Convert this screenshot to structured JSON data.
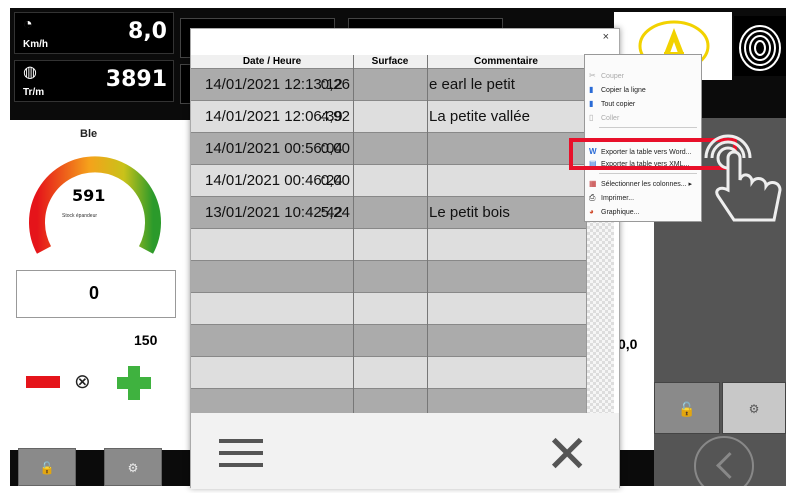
{
  "speed": {
    "value": "8,0",
    "unit": "Km/h",
    "icon": "speedometer-icon"
  },
  "rotation": {
    "value": "3891",
    "unit": "Tr/m",
    "icon": "rotor-icon"
  },
  "left_panel": {
    "crop_name": "Ble",
    "gauge_value": "591",
    "gauge_sub": "Stock épandeur",
    "counter": "0",
    "rate": "150"
  },
  "right_panel": {
    "rate_partial": "0,0"
  },
  "table": {
    "headers": {
      "date": "Date / Heure",
      "surface": "Surface",
      "comment": "Commentaire"
    },
    "rows": [
      {
        "date": "14/01/2021 12:13:12",
        "surface": "0,26",
        "comment": "e earl le petit"
      },
      {
        "date": "14/01/2021 12:06:39",
        "surface": "4,92",
        "comment": "La petite vallée"
      },
      {
        "date": "14/01/2021 00:56:04",
        "surface": "0,00",
        "comment": ""
      },
      {
        "date": "14/01/2021 00:46:24",
        "surface": "0,00",
        "comment": ""
      },
      {
        "date": "13/01/2021 10:42:42",
        "surface": "5,24",
        "comment": "Le petit bois"
      }
    ],
    "close_glyph": "×"
  },
  "context_menu": {
    "items": [
      {
        "label": "Couper",
        "icon": "scissors-icon"
      },
      {
        "label": "Copier la ligne",
        "icon": "copy-icon"
      },
      {
        "label": "Tout copier",
        "icon": "copy-all-icon"
      },
      {
        "label": "Coller",
        "icon": "paste-icon"
      },
      {
        "label": "Exporter la table vers Word...",
        "icon": "word-icon"
      },
      {
        "label": "Exporter la table vers XML...",
        "icon": "xml-icon"
      },
      {
        "label": "Sélectionner les colonnes...",
        "icon": "columns-icon"
      },
      {
        "label": "Imprimer...",
        "icon": "printer-icon"
      },
      {
        "label": "Graphique...",
        "icon": "chart-icon"
      }
    ]
  },
  "colors": {
    "accent_red": "#e8102a",
    "minus_red": "#e5141a",
    "plus_green": "#3fb23f",
    "logo_yellow": "#f2d200"
  }
}
